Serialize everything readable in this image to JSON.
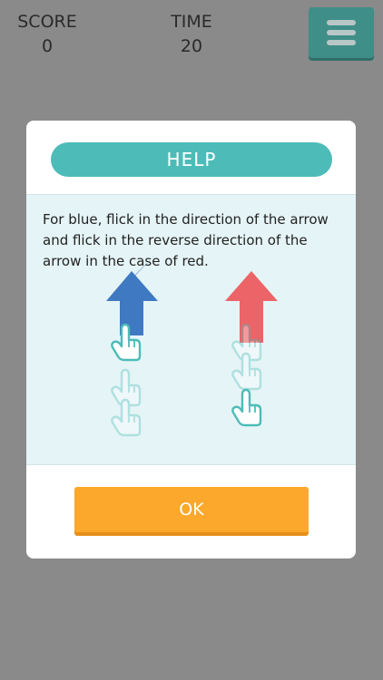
{
  "hud": {
    "score_label": "SCORE",
    "score_value": "0",
    "time_label": "TIME",
    "time_value": "20"
  },
  "menu": {
    "icon": "hamburger-menu-icon"
  },
  "dialog": {
    "title": "HELP",
    "description": "For blue, flick in the direction of the arrow and flick in the reverse direction of the arrow in the case of red.",
    "ok_label": "OK",
    "illustration": {
      "blue_arrow": {
        "direction": "up",
        "color": "#3f79c2",
        "gesture": "flick-up"
      },
      "red_arrow": {
        "direction": "up",
        "color": "#ec6467",
        "gesture": "flick-down"
      }
    }
  },
  "colors": {
    "background": "#8a8a8a",
    "teal": "#4dbcb8",
    "orange": "#fca82c",
    "panel": "#e5f4f6"
  }
}
